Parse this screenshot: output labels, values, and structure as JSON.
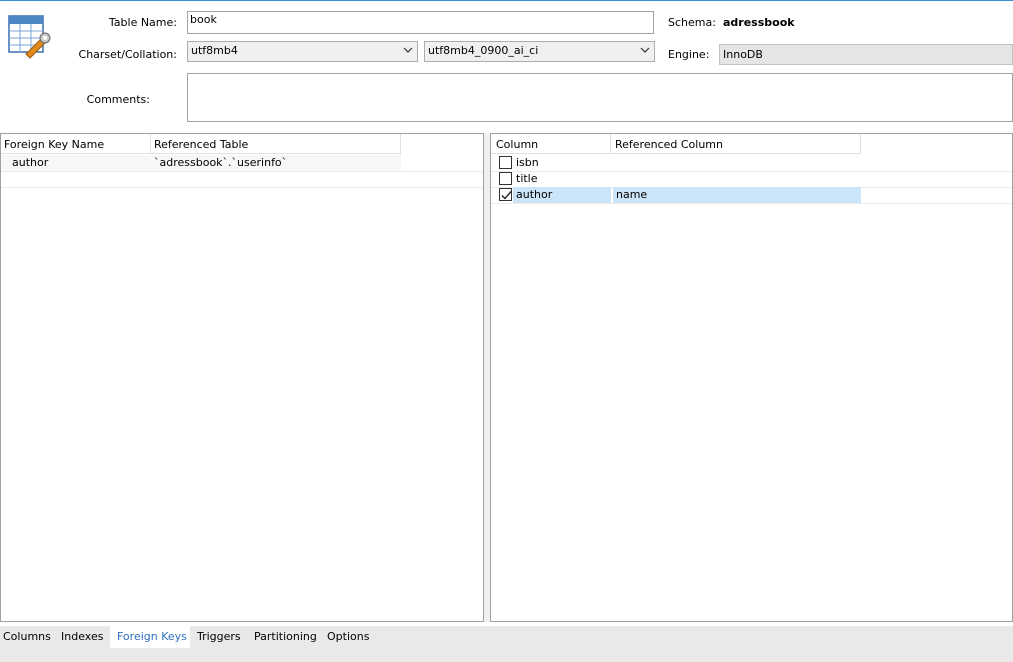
{
  "header": {
    "table_name_label": "Table Name:",
    "table_name_value": "book",
    "charset_label": "Charset/Collation:",
    "charset_value": "utf8mb4",
    "collation_value": "utf8mb4_0900_ai_ci",
    "comments_label": "Comments:",
    "comments_value": "",
    "schema_label": "Schema:",
    "schema_value": "adressbook",
    "engine_label": "Engine:",
    "engine_value": "InnoDB",
    "icon": "table-edit-icon"
  },
  "foreign_keys": {
    "headers": [
      "Foreign Key Name",
      "Referenced Table"
    ],
    "rows": [
      {
        "name": "author",
        "referenced_table": "`adressbook`.`userinfo`"
      }
    ]
  },
  "fk_columns": {
    "headers": [
      "Column",
      "Referenced Column"
    ],
    "rows": [
      {
        "column": "isbn",
        "checked": false,
        "referenced_column": ""
      },
      {
        "column": "title",
        "checked": false,
        "referenced_column": ""
      },
      {
        "column": "author",
        "checked": true,
        "referenced_column": "name"
      }
    ]
  },
  "tabs": [
    {
      "label": "Columns",
      "active": false
    },
    {
      "label": "Indexes",
      "active": false
    },
    {
      "label": "Foreign Keys",
      "active": true
    },
    {
      "label": "Triggers",
      "active": false
    },
    {
      "label": "Partitioning",
      "active": false
    },
    {
      "label": "Options",
      "active": false
    }
  ],
  "colors": {
    "accent": "#2f6fbf",
    "selection": "#cce4f7"
  }
}
